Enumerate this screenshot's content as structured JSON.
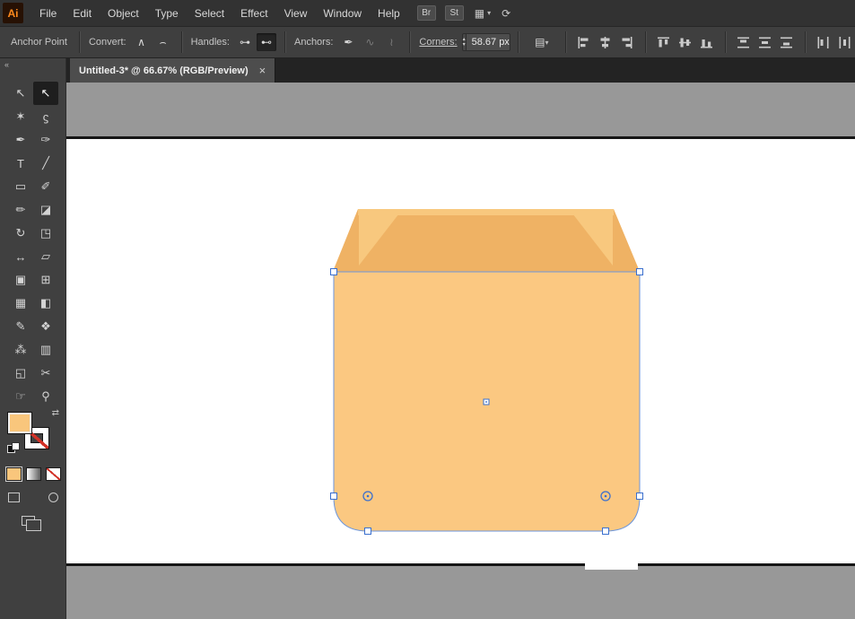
{
  "app": {
    "logo_text": "Ai"
  },
  "menu": {
    "items": [
      "File",
      "Edit",
      "Object",
      "Type",
      "Select",
      "Effect",
      "View",
      "Window",
      "Help"
    ],
    "bridge_badge": "Br",
    "stock_badge": "St",
    "workspace_glyph": "▦",
    "chevron_glyph": "▾",
    "sync_glyph": "⟳"
  },
  "control_bar": {
    "title": "Anchor Point",
    "convert_label": "Convert:",
    "handles_label": "Handles:",
    "anchors_label": "Anchors:",
    "corners_label": "Corners:",
    "corners_value": "58.67 px",
    "icons": {
      "convert_corner": "∧",
      "convert_smooth": "⌢",
      "handles_show": "⊶",
      "handles_hide": "⊷",
      "anchor_pen": "✒",
      "anchor_join": "∿",
      "anchor_cut": "≀",
      "stepper_up": "▴",
      "stepper_down": "▾",
      "preset": "▤",
      "chevron_down": "▾"
    }
  },
  "tab_bar": {
    "collapse_glyph": "«",
    "title": "Untitled-3* @ 66.67% (RGB/Preview)",
    "close_glyph": "×"
  },
  "toolbar": {
    "swap_glyph": "⇄",
    "tools": [
      {
        "name": "selection-tool",
        "glyph": "↖"
      },
      {
        "name": "direct-selection-tool",
        "glyph": "↖",
        "active": true
      },
      {
        "name": "magic-wand-tool",
        "glyph": "✶"
      },
      {
        "name": "lasso-tool",
        "glyph": "ϛ"
      },
      {
        "name": "pen-tool",
        "glyph": "✒"
      },
      {
        "name": "curvature-tool",
        "glyph": "✑"
      },
      {
        "name": "type-tool",
        "glyph": "T"
      },
      {
        "name": "line-segment-tool",
        "glyph": "╱"
      },
      {
        "name": "rectangle-tool",
        "glyph": "▭"
      },
      {
        "name": "paintbrush-tool",
        "glyph": "✐"
      },
      {
        "name": "pencil-tool",
        "glyph": "✏"
      },
      {
        "name": "eraser-tool",
        "glyph": "◪"
      },
      {
        "name": "rotate-tool",
        "glyph": "↻"
      },
      {
        "name": "scale-tool",
        "glyph": "◳"
      },
      {
        "name": "width-tool",
        "glyph": "↔"
      },
      {
        "name": "free-transform-tool",
        "glyph": "▱"
      },
      {
        "name": "shape-builder-tool",
        "glyph": "▣"
      },
      {
        "name": "perspective-grid-tool",
        "glyph": "⊞"
      },
      {
        "name": "mesh-tool",
        "glyph": "▦"
      },
      {
        "name": "gradient-tool",
        "glyph": "◧"
      },
      {
        "name": "eyedropper-tool",
        "glyph": "✎"
      },
      {
        "name": "blend-tool",
        "glyph": "❖"
      },
      {
        "name": "symbol-sprayer-tool",
        "glyph": "⁂"
      },
      {
        "name": "column-graph-tool",
        "glyph": "▥"
      },
      {
        "name": "artboard-tool",
        "glyph": "◱"
      },
      {
        "name": "slice-tool",
        "glyph": "✂"
      },
      {
        "name": "hand-tool",
        "glyph": "☞"
      },
      {
        "name": "zoom-tool",
        "glyph": "⚲"
      }
    ]
  },
  "artwork": {
    "body_color": "#FBC881",
    "flap_color": "#EFB264",
    "flap_light_color": "#F8C87E",
    "selection_color": "#3A6FCE",
    "fill_swatch_color": "#F9C67C",
    "stroke": "none"
  },
  "colors": {
    "pasteboard": "#989898",
    "artboard": "#FFFFFF",
    "ui_dark": "#323232",
    "ui_panel": "#404040"
  }
}
